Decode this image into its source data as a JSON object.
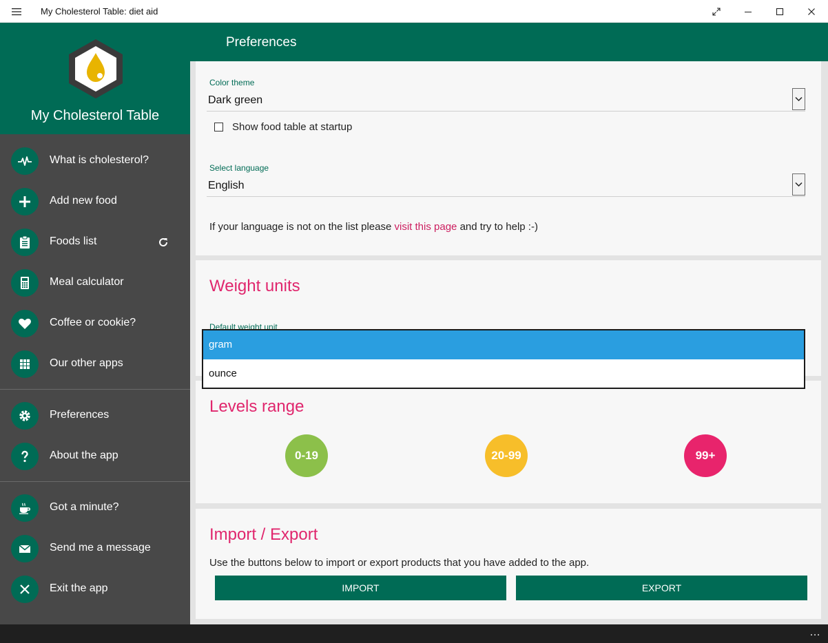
{
  "window": {
    "title": "My Cholesterol Table: diet aid"
  },
  "sidebar": {
    "app_name": "My Cholesterol Table",
    "items": [
      {
        "label": "What is cholesterol?",
        "icon": "heartbeat-icon"
      },
      {
        "label": "Add new food",
        "icon": "plus-icon"
      },
      {
        "label": "Foods list",
        "icon": "clipboard-icon"
      },
      {
        "label": "Meal calculator",
        "icon": "calculator-icon"
      },
      {
        "label": "Coffee or cookie?",
        "icon": "heart-icon"
      },
      {
        "label": "Our other apps",
        "icon": "grid-icon"
      },
      {
        "label": "Preferences",
        "icon": "gear-icon"
      },
      {
        "label": "About the app",
        "icon": "question-icon"
      },
      {
        "label": "Got a minute?",
        "icon": "coffee-cup-icon"
      },
      {
        "label": "Send me a message",
        "icon": "envelope-icon"
      },
      {
        "label": "Exit the app",
        "icon": "close-icon"
      }
    ]
  },
  "header": {
    "title": "Preferences"
  },
  "general": {
    "color_theme_label": "Color theme",
    "color_theme_value": "Dark green",
    "show_table_label": "Show food table at startup",
    "show_table_checked": false,
    "language_label": "Select language",
    "language_value": "English",
    "language_info_before": "If your language is not on the list please ",
    "language_info_link": "visit this page",
    "language_info_after": " and try to help :-)"
  },
  "weight": {
    "title": "Weight units",
    "default_label": "Default weight unit",
    "options": [
      "gram",
      "ounce"
    ],
    "selected": "gram"
  },
  "levels": {
    "title": "Levels range",
    "ranges": [
      {
        "label": "0-19",
        "color": "#8cc04a"
      },
      {
        "label": "20-99",
        "color": "#f7be2a"
      },
      {
        "label": "99+",
        "color": "#e8246c"
      }
    ]
  },
  "import_export": {
    "title": "Import / Export",
    "description": "Use the buttons below to import or export products that you have added to the app.",
    "import_label": "IMPORT",
    "export_label": "EXPORT"
  },
  "taskbar": {
    "more_label": "…"
  },
  "colors": {
    "primary": "#006b55",
    "sidebar": "#484848",
    "accent": "#e0266d",
    "selection": "#2a9ee0"
  }
}
